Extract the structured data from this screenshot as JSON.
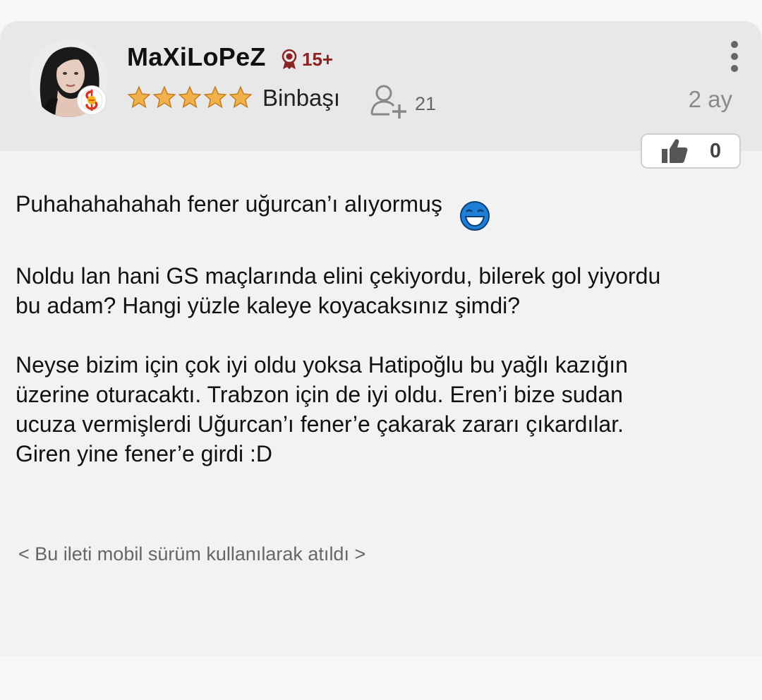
{
  "post": {
    "author": {
      "username": "MaXiLoPeZ",
      "level_badge": "15+",
      "rank": "Binbaşı",
      "star_count": 5,
      "follower_count": "21",
      "team_badge_icon": "galatasaray-logo-icon"
    },
    "timestamp": "2 ay",
    "likes": "0",
    "body": {
      "paragraph1": "Puhahahahahah fener uğurcan’ı alıyormuş",
      "paragraph2_line1": "Noldu lan hani GS maçlarında elini çekiyordu, bilerek gol yiyordu",
      "paragraph2_line2": "bu adam? Hangi yüzle kaleye koyacaksınız şimdi?",
      "paragraph3_line1": "Neyse bizim için çok iyi oldu yoksa Hatipoğlu bu yağlı kazığın",
      "paragraph3_line2": "üzerine oturacaktı. Trabzon için de iyi oldu. Eren’i bize sudan",
      "paragraph3_line3": "ucuza vermişlerdi Uğurcan’ı fener’e çakarak zararı çıkardılar.",
      "paragraph3_line4": "Giren yine fener’e girdi :D"
    },
    "mobile_note": "< Bu ileti mobil sürüm kullanılarak atıldı >"
  },
  "colors": {
    "header_bg": "#e8e8e8",
    "card_bg": "#f2f2f2",
    "level_badge": "#8b2323",
    "star": "#e8a33a",
    "smiley": "#1e7fd8"
  }
}
